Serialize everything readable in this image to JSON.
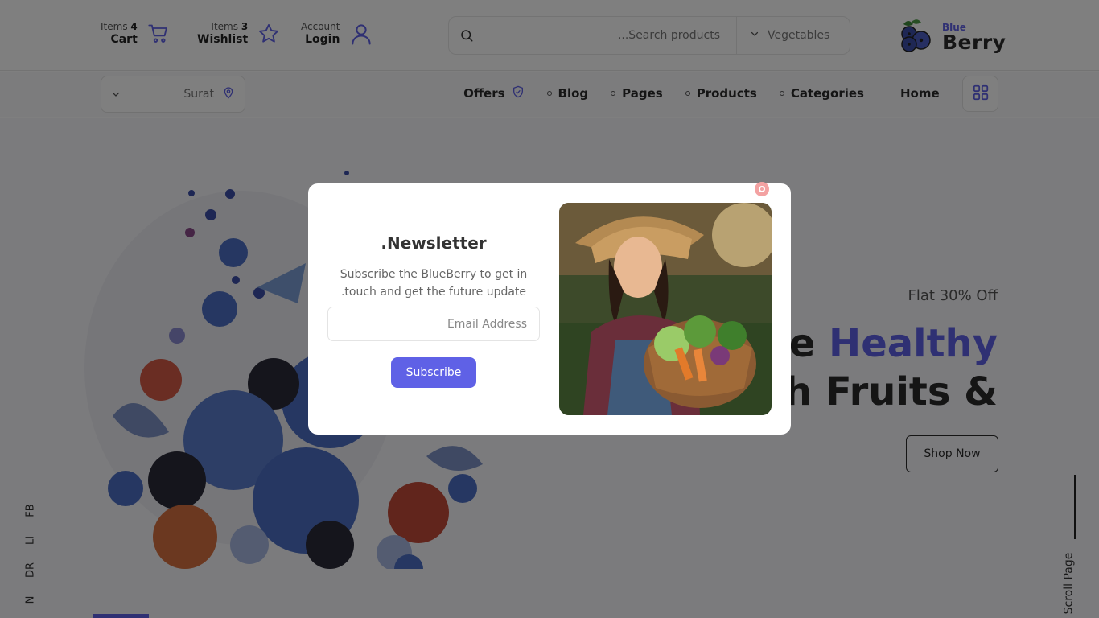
{
  "header": {
    "cart": {
      "small": "Items",
      "count": "4",
      "label": "Cart"
    },
    "wishlist": {
      "small": "Items",
      "count": "3",
      "label": "Wishlist"
    },
    "account": {
      "small": "Account",
      "label": "Login"
    },
    "search": {
      "placeholder": "...Search products",
      "category": "Vegetables"
    },
    "logo": {
      "small": "Blue",
      "big": "Berry"
    }
  },
  "nav": {
    "location": "Surat",
    "links": {
      "offers": "Offers",
      "blog": "Blog",
      "pages": "Pages",
      "products": "Products",
      "categories": "Categories",
      "home": "Home"
    }
  },
  "hero": {
    "offer": "Flat 30% Off",
    "line1_prefix": "re",
    "line1_accent": "Healthy",
    "line2": "sh Fruits &",
    "button": "Shop Now",
    "scroll": "Scroll Page",
    "social": [
      "FB",
      "LI",
      "DR",
      "N"
    ]
  },
  "modal": {
    "title": ".Newsletter",
    "text": "Subscribe the BlueBerry to get in .touch and get the future update",
    "email_placeholder": "Email Address",
    "button": "Subscribe"
  },
  "colors": {
    "accent": "#5f61e6",
    "close": "#f3a2a2"
  }
}
